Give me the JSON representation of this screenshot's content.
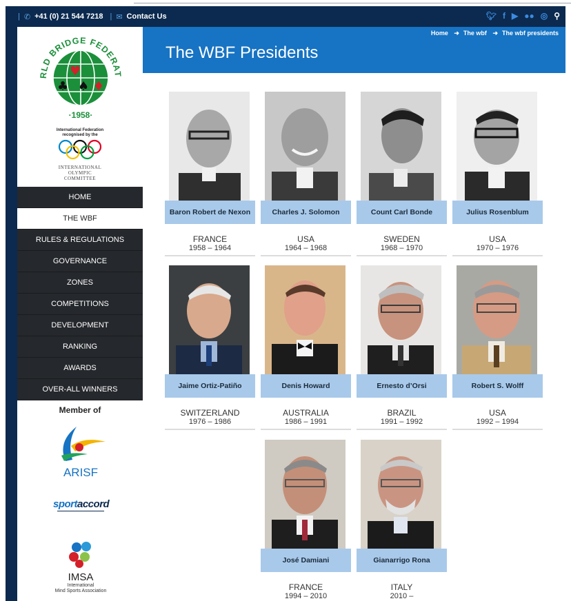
{
  "topbar": {
    "phone": "+41 (0) 21 544 7218",
    "contact": "Contact Us",
    "social_icons": [
      "twitter-icon",
      "facebook-icon",
      "youtube-icon",
      "flickr-icon",
      "instagram-icon",
      "search-icon"
    ]
  },
  "sidebar": {
    "logo_text_top": "WORLD BRIDGE FEDERATION",
    "logo_text_bottom": "·1958·",
    "ioc_line1": "International Federation",
    "ioc_line2": "recognised by the",
    "ioc_name_1": "INTERNATIONAL",
    "ioc_name_2": "OLYMPIC",
    "ioc_name_3": "COMMITTEE",
    "nav": [
      {
        "label": "HOME",
        "stripe": "#25282c"
      },
      {
        "label": "THE WBF",
        "stripe": "#1773c3"
      },
      {
        "label": "RULES & REGULATIONS",
        "stripe": "#3a6fa8"
      },
      {
        "label": "GOVERNANCE",
        "stripe": "#22a35a"
      },
      {
        "label": "ZONES",
        "stripe": "#e86f2a"
      },
      {
        "label": "COMPETITIONS",
        "stripe": "#c2203a"
      },
      {
        "label": "DEVELOPMENT",
        "stripe": "#7a3a5a"
      },
      {
        "label": "RANKING",
        "stripe": "#b0479a"
      },
      {
        "label": "AWARDS",
        "stripe": "#8a4ab0"
      },
      {
        "label": "OVER-ALL WINNERS",
        "stripe": "#a07aa8"
      }
    ],
    "member_of": "Member of",
    "arisf": "ARISF",
    "sportaccord_1": "sport",
    "sportaccord_2": "accord",
    "imsa": "IMSA",
    "imsa_sub1": "International",
    "imsa_sub2": "Mind Sports Association"
  },
  "header": {
    "breadcrumb": [
      "Home",
      "The wbf",
      "The wbf presidents"
    ],
    "title": "The WBF Presidents"
  },
  "presidents": [
    {
      "name": "Baron Robert de Nexon",
      "country": "FRANCE",
      "years": "1958 – 1964"
    },
    {
      "name": "Charles J. Solomon",
      "country": "USA",
      "years": "1964 – 1968"
    },
    {
      "name": "Count Carl Bonde",
      "country": "SWEDEN",
      "years": "1968 – 1970"
    },
    {
      "name": "Julius Rosenblum",
      "country": "USA",
      "years": "1970 – 1976"
    },
    {
      "name": "Jaime Ortiz-Patiño",
      "country": "SWITZERLAND",
      "years": "1976 – 1986"
    },
    {
      "name": "Denis Howard",
      "country": "AUSTRALIA",
      "years": "1986 – 1991"
    },
    {
      "name": "Ernesto d’Orsi",
      "country": "BRAZIL",
      "years": "1991 – 1992"
    },
    {
      "name": "Robert S. Wolff",
      "country": "USA",
      "years": "1992 – 1994"
    },
    {
      "name": "José Damiani",
      "country": "FRANCE",
      "years": "1994 – 2010"
    },
    {
      "name": "Gianarrigo Rona",
      "country": "ITALY",
      "years": "2010 –"
    }
  ],
  "colors": {
    "frame": "#0c2a4f",
    "header_blue": "#1773c3",
    "namebar": "#a8c9ea",
    "nav_dark": "#25282c"
  }
}
